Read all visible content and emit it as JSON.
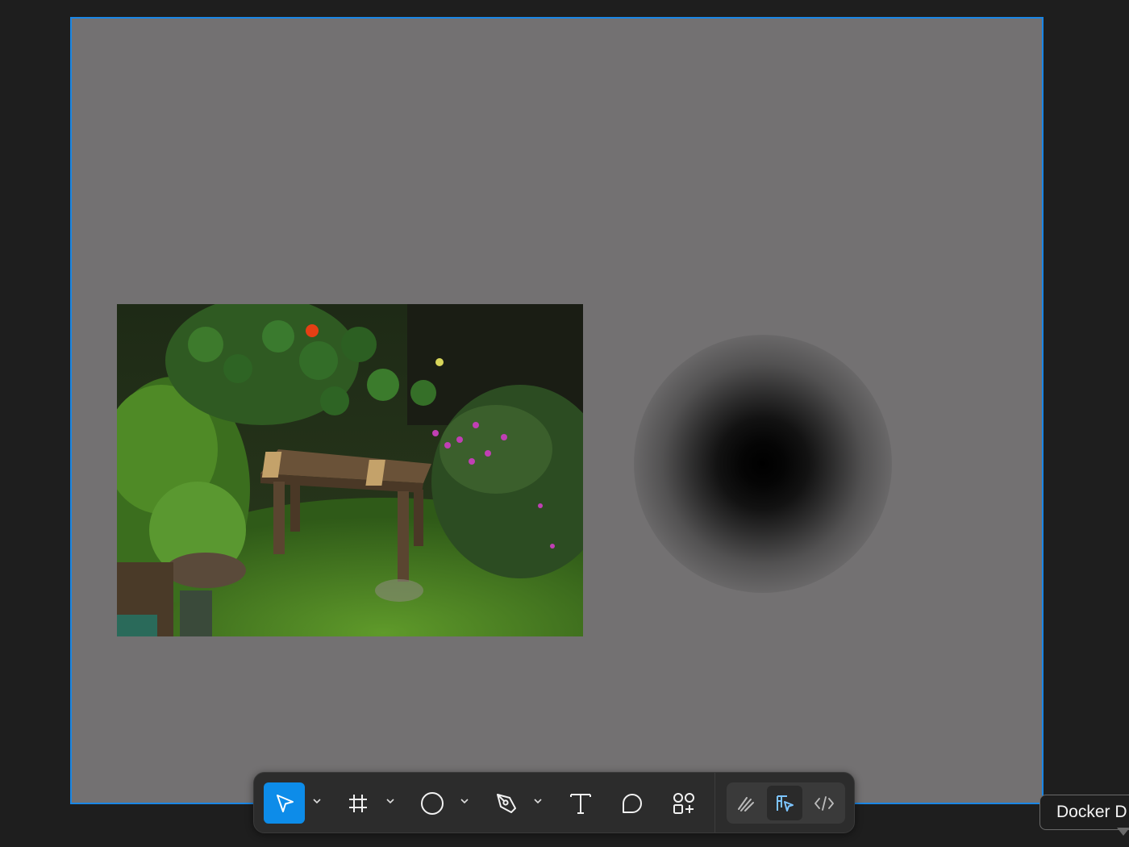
{
  "canvas": {
    "background": "#1e1e1e",
    "frame_fill": "#737172",
    "frame_selection_color": "#1a86e5"
  },
  "image": {
    "description_icon": "image-fill",
    "subject": "garden-bench-photo"
  },
  "blur_effect": {
    "shape": "ellipse",
    "center_color": "#000000"
  },
  "toolbar": {
    "tools": [
      {
        "id": "move",
        "icon": "cursor-arrow-icon",
        "active": true,
        "has_menu": true
      },
      {
        "id": "frame",
        "icon": "hash-frame-icon",
        "active": false,
        "has_menu": true
      },
      {
        "id": "shape",
        "icon": "ellipse-icon",
        "active": false,
        "has_menu": true
      },
      {
        "id": "pen",
        "icon": "pen-nib-icon",
        "active": false,
        "has_menu": true
      },
      {
        "id": "text",
        "icon": "text-t-icon",
        "active": false,
        "has_menu": false
      },
      {
        "id": "comment",
        "icon": "comment-bubble-icon",
        "active": false,
        "has_menu": false
      },
      {
        "id": "actions",
        "icon": "shapes-plus-icon",
        "active": false,
        "has_menu": false
      }
    ],
    "modes": [
      {
        "id": "draw",
        "icon": "draw-squiggle-icon",
        "active": false
      },
      {
        "id": "design",
        "icon": "design-mode-icon",
        "active": true
      },
      {
        "id": "dev",
        "icon": "code-brackets-icon",
        "active": false
      }
    ],
    "active_color": "#0d8ce9",
    "design_mode_color": "#7cc4ff"
  },
  "tooltip": {
    "text": "Docker D"
  }
}
